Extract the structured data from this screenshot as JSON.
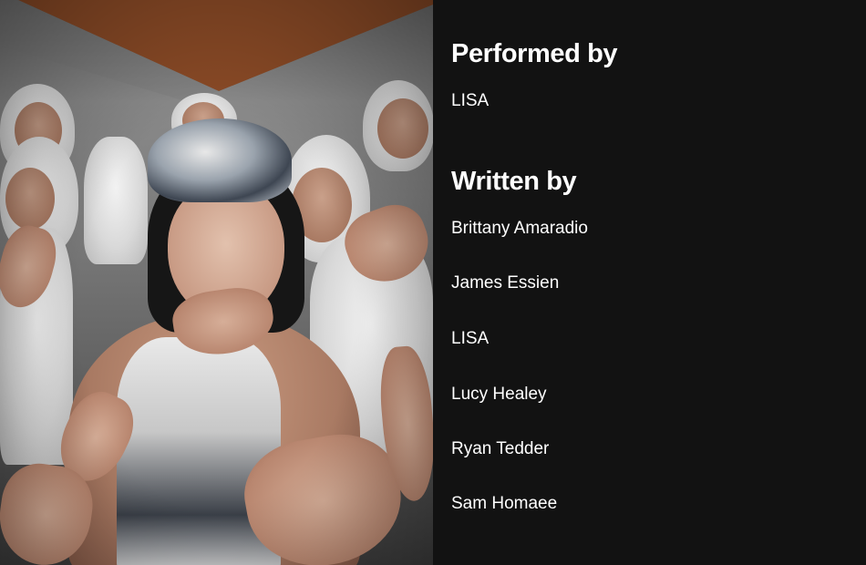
{
  "artwork": {
    "icon": "music-video-still"
  },
  "credits": {
    "performed_by": {
      "title": "Performed by",
      "names": [
        "LISA"
      ]
    },
    "written_by": {
      "title": "Written by",
      "names": [
        "Brittany Amaradio",
        "James Essien",
        "LISA",
        "Lucy Healey",
        "Ryan Tedder",
        "Sam Homaee"
      ]
    }
  },
  "colors": {
    "panel_background": "#121212",
    "text": "#ffffff",
    "ceiling_accent": "#8a4a26"
  }
}
